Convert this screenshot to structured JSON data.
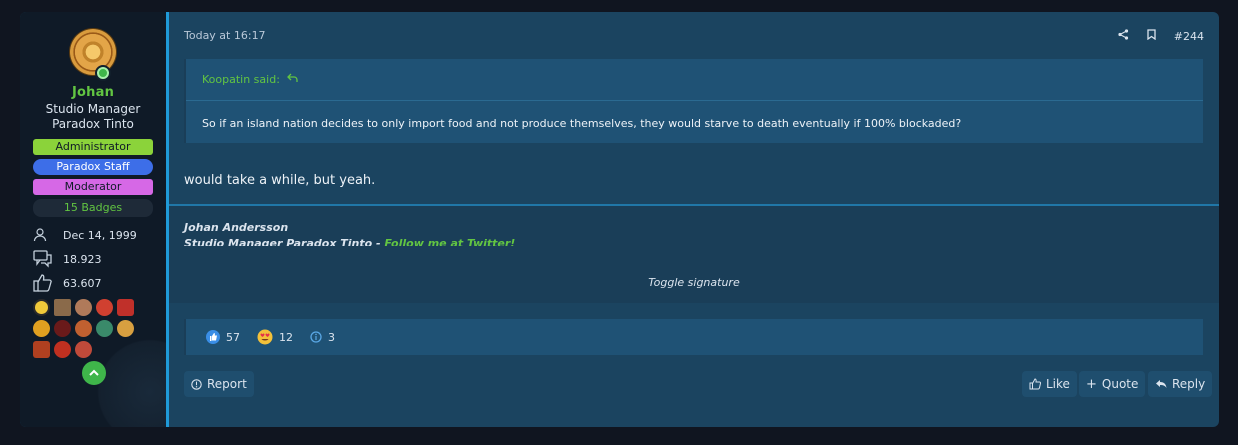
{
  "user": {
    "name": "Johan",
    "title_line1": "Studio Manager",
    "title_line2": "Paradox Tinto",
    "banners": {
      "admin": "Administrator",
      "staff": "Paradox Staff",
      "moderator": "Moderator",
      "badges": "15 Badges"
    },
    "stats": {
      "joined": "Dec 14, 1999",
      "messages": "18.923",
      "reactions": "63.607"
    },
    "icons": {
      "joined": "person-icon",
      "messages": "chat-bubbles-icon",
      "reactions": "thumbs-up-icon"
    }
  },
  "post": {
    "timestamp": "Today at 16:17",
    "number": "#244",
    "quote": {
      "author": "Koopatin said:",
      "text": "So if an island nation decides to only import food and not produce themselves, they would starve to death eventually if 100% blockaded?"
    },
    "message": "would take a while, but yeah.",
    "signature": {
      "name": "Johan Andersson",
      "line": "Studio Manager Paradox Tinto - ",
      "link": "Follow me at Twitter!",
      "toggle": "Toggle signature"
    },
    "reactions": [
      {
        "icon": "like-reaction-icon",
        "count": "57"
      },
      {
        "icon": "love-reaction-icon",
        "count": "12"
      },
      {
        "icon": "info-reaction-icon",
        "count": "3"
      }
    ],
    "buttons": {
      "report": "Report",
      "like": "Like",
      "quote": "Quote",
      "reply": "Reply"
    }
  },
  "colors": {
    "accent_green": "#62c542",
    "left_border": "#1f9ad8",
    "post_bg": "#1b4460",
    "quote_bg": "#1f5275"
  }
}
